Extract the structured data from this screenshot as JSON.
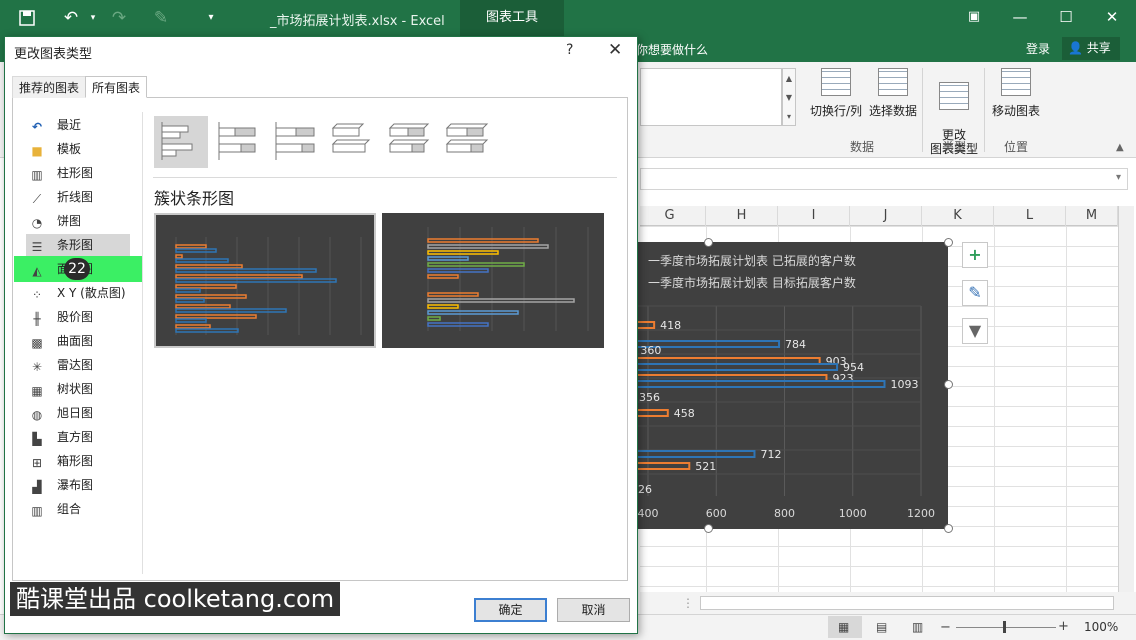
{
  "window": {
    "doc_title": "_市场拓展计划表.xlsx - Excel",
    "chart_tools_tab": "图表工具",
    "tell_me": "你想要做什么",
    "login": "登录",
    "share": "共享",
    "minimize_icon": "minimize-icon",
    "maximize_icon": "maximize-icon",
    "close_icon": "close-icon"
  },
  "ribbon": {
    "switch_row_col": "切换行/列",
    "select_data": "选择数据",
    "change_type": "更改\n图表类型",
    "move_chart": "移动图表",
    "group_data": "数据",
    "group_type": "类型",
    "group_location": "位置"
  },
  "grid": {
    "columns": [
      "G",
      "H",
      "I",
      "J",
      "K",
      "L",
      "M"
    ]
  },
  "chart": {
    "title_line1": "一季度市场拓展计划表 已拓展的客户数",
    "title_line2": "一季度市场拓展计划表 目标拓展客户数",
    "x_ticks": [
      "400",
      "600",
      "800",
      "1000",
      "1200"
    ],
    "bar_labels": [
      "418",
      "784",
      "360",
      "903",
      "954",
      "923",
      "1093",
      "356",
      "458",
      "712",
      "521",
      "26"
    ]
  },
  "chart_data": {
    "type": "bar",
    "orientation": "horizontal",
    "visible_x_range": [
      400,
      1200
    ],
    "series": [
      {
        "name": "一季度市场拓展计划表 已拓展的客户数",
        "color": "#ed7d31",
        "values": [
          418,
          360,
          903,
          923,
          356,
          458,
          521,
          26
        ]
      },
      {
        "name": "一季度市场拓展计划表 目标拓展客户数",
        "color": "#2e75b6",
        "values": [
          784,
          954,
          1093,
          712
        ]
      }
    ]
  },
  "dialog": {
    "title": "更改图表类型",
    "help": "?",
    "close": "✕",
    "tabs": [
      "推荐的图表",
      "所有图表"
    ],
    "chart_types": [
      "最近",
      "模板",
      "柱形图",
      "折线图",
      "饼图",
      "条形图",
      "面积图",
      "X Y (散点图)",
      "股价图",
      "曲面图",
      "雷达图",
      "树状图",
      "旭日图",
      "直方图",
      "箱形图",
      "瀑布图",
      "组合"
    ],
    "selected_type": "簇状条形图",
    "step_badge": "22",
    "ok": "确定",
    "cancel": "取消"
  },
  "status": {
    "zoom": "100%"
  },
  "watermark": "酷课堂出品 coolketang.com",
  "colors": {
    "excel_green": "#217346",
    "highlight": "#3bef64",
    "chart_bg": "#404040"
  }
}
